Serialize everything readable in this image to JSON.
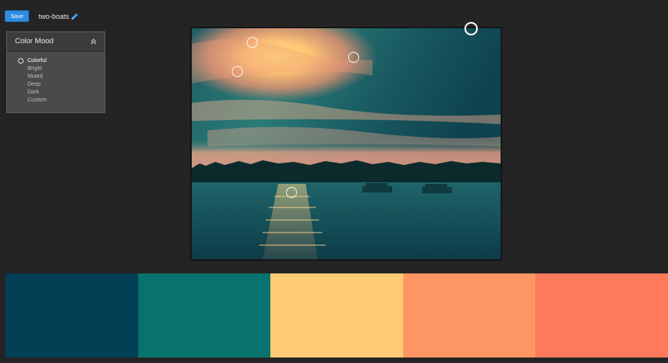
{
  "toolbar": {
    "save_label": "Save",
    "document_title": "two-boats"
  },
  "mood_panel": {
    "title": "Color Mood",
    "options": [
      "Colorful",
      "Bright",
      "Muted",
      "Deep",
      "Dark",
      "Custom"
    ],
    "selected": "Colorful"
  },
  "palette": {
    "swatches": [
      "#033f55",
      "#08736e",
      "#fdcb74",
      "#fe9663",
      "#fd7a5a"
    ],
    "selected_index": null
  },
  "icons": {
    "edit": "pencil-icon",
    "collapse": "chevron-up-double-icon",
    "radio": "radio-icon",
    "picker": "color-picker-circle"
  },
  "image": {
    "subject": "two-boats"
  }
}
